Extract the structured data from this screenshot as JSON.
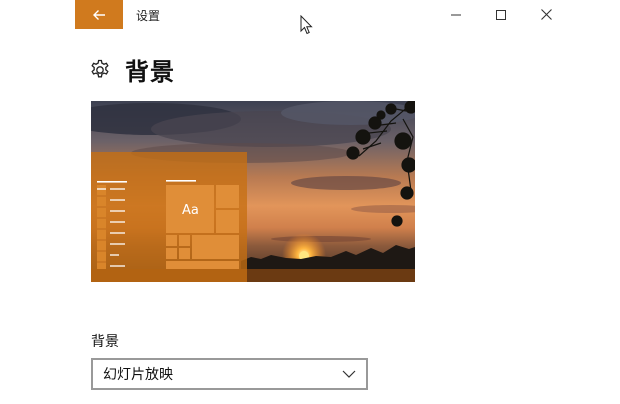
{
  "window": {
    "title": "设置"
  },
  "icons": {
    "back": "back-arrow-icon",
    "minimize": "minimize-icon",
    "maximize": "maximize-icon",
    "close": "close-icon",
    "settings": "gear-icon",
    "dropdown": "chevron-down-icon"
  },
  "page": {
    "title": "背景"
  },
  "preview": {
    "sample_text": "Aa"
  },
  "background_setting": {
    "label": "背景",
    "selected_value": "幻灯片放映"
  },
  "colors": {
    "accent": "#d07a1e"
  }
}
